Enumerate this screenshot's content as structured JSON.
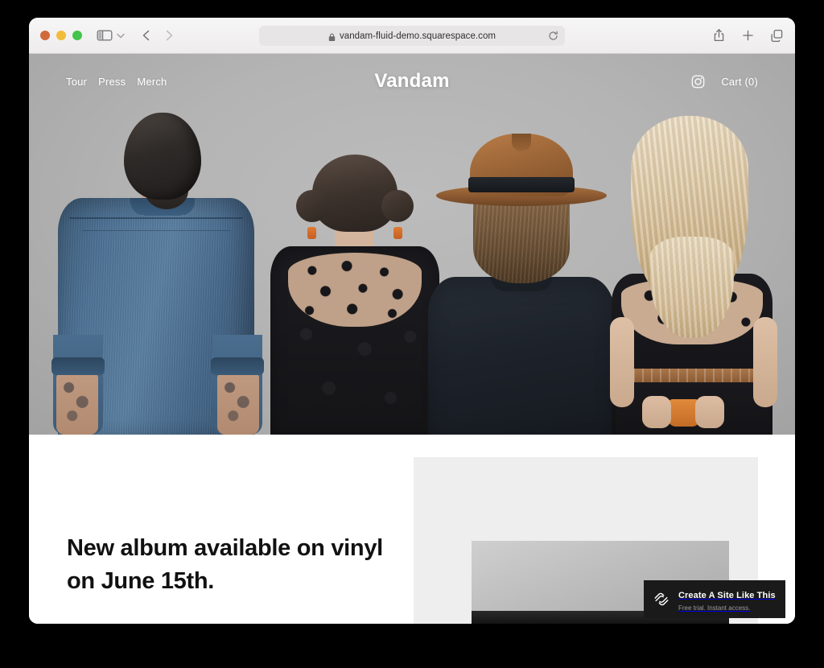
{
  "browser": {
    "traffic_lights": [
      "close",
      "minimize",
      "maximize"
    ],
    "sidebar_icon": "sidebar-icon",
    "sidebar_chevron_icon": "chevron-down-icon",
    "back_icon": "chevron-left-icon",
    "forward_icon": "chevron-right-icon",
    "address": {
      "lock_icon": "lock-icon",
      "url": "vandam-fluid-demo.squarespace.com",
      "reload_icon": "reload-icon"
    },
    "actions": {
      "share_icon": "share-icon",
      "new_tab_icon": "plus-icon",
      "tab_overview_icon": "tabs-icon"
    }
  },
  "site": {
    "nav": [
      {
        "label": "Tour"
      },
      {
        "label": "Press"
      },
      {
        "label": "Merch"
      }
    ],
    "logo": "Vandam",
    "instagram_icon": "instagram-icon",
    "cart_label": "Cart (0)",
    "hero": {
      "description": "Four band members photographed from behind against a gray studio wall"
    },
    "headline": "New album available on vinyl on June 15th."
  },
  "promo": {
    "logo_icon": "squarespace-logo-icon",
    "title": "Create A Site Like This",
    "subtitle": "Free trial. Instant access."
  },
  "colors": {
    "page_background": "#000000",
    "toolbar": "#f2f0f0",
    "hero_backdrop": "#b3b3b3",
    "promo_background": "#1a1a1a",
    "headline": "#111111",
    "card": "#eeeeee"
  }
}
